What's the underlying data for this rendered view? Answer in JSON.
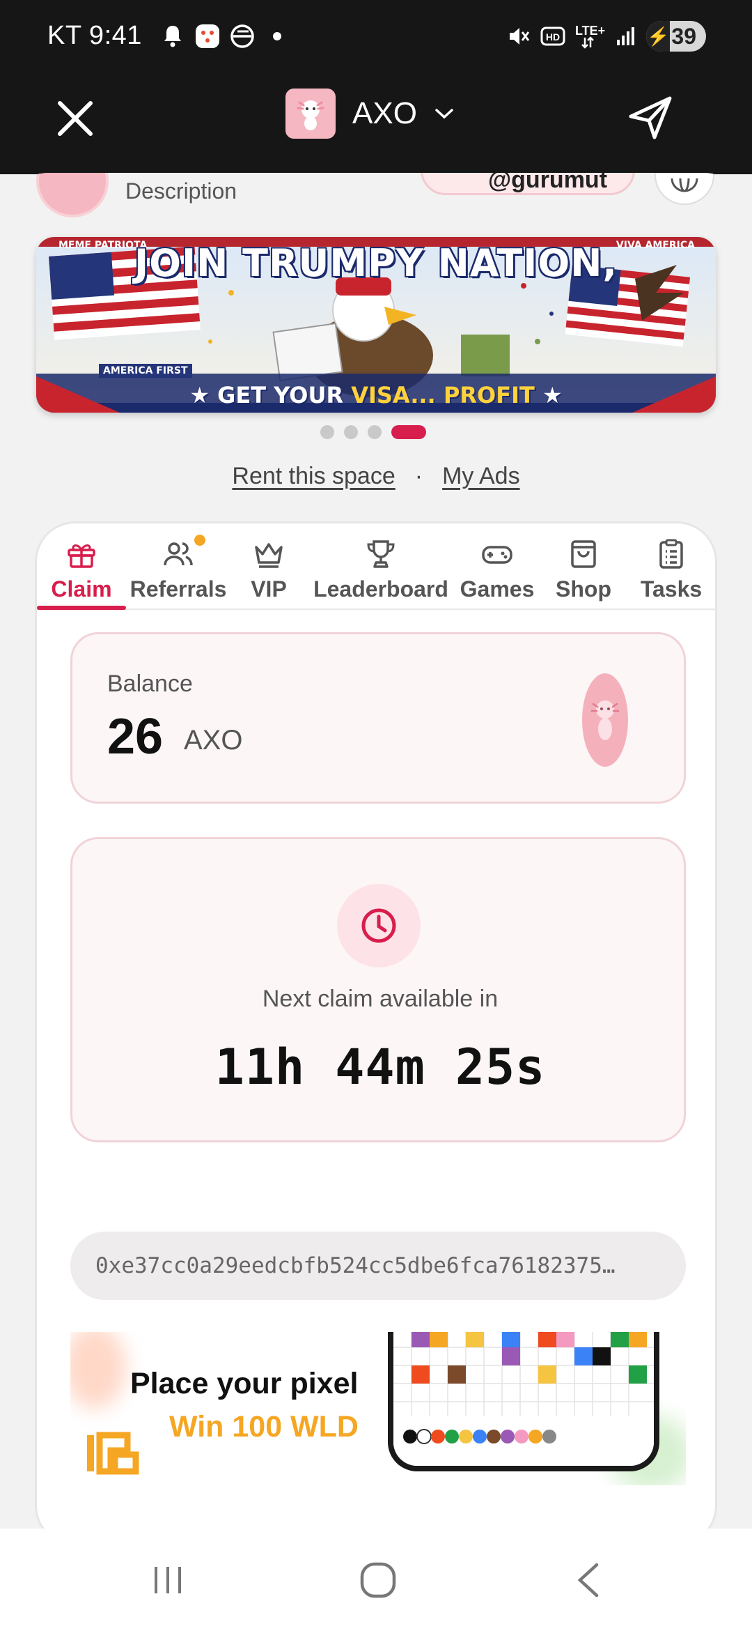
{
  "status_bar": {
    "time": "KT 9:41",
    "battery": "39"
  },
  "app_bar": {
    "title": "AXO"
  },
  "header": {
    "description": "Description",
    "handle": "@gurumut"
  },
  "banner": {
    "title": "JOIN TRUMPY NATION,",
    "subtitle_part1": "GET YOUR ",
    "subtitle_highlight": "VISA... PROFIT",
    "tag_left": "MEME PATRIOTA",
    "tag_right": "VIVA AMERICA",
    "tag_sign": "AMERICA FIRST"
  },
  "ads": {
    "rent": "Rent this space",
    "separator": "·",
    "my_ads": "My Ads"
  },
  "tabs": [
    {
      "label": "Claim"
    },
    {
      "label": "Referrals"
    },
    {
      "label": "VIP"
    },
    {
      "label": "Leaderboard"
    },
    {
      "label": "Games"
    },
    {
      "label": "Shop"
    },
    {
      "label": "Tasks"
    }
  ],
  "balance": {
    "label": "Balance",
    "value": "26",
    "unit": "AXO"
  },
  "claim": {
    "text": "Next claim available in",
    "countdown": "11h 44m 25s"
  },
  "wallet": {
    "address": "0xe37cc0a29eedcbfb524cc5dbe6fca76182375…"
  },
  "promo": {
    "title": "Place your pixel",
    "subtitle": "Win 100 WLD"
  },
  "colors": {
    "accent": "#d81e4c",
    "topbar": "#161616",
    "promo_orange": "#f5a623"
  }
}
